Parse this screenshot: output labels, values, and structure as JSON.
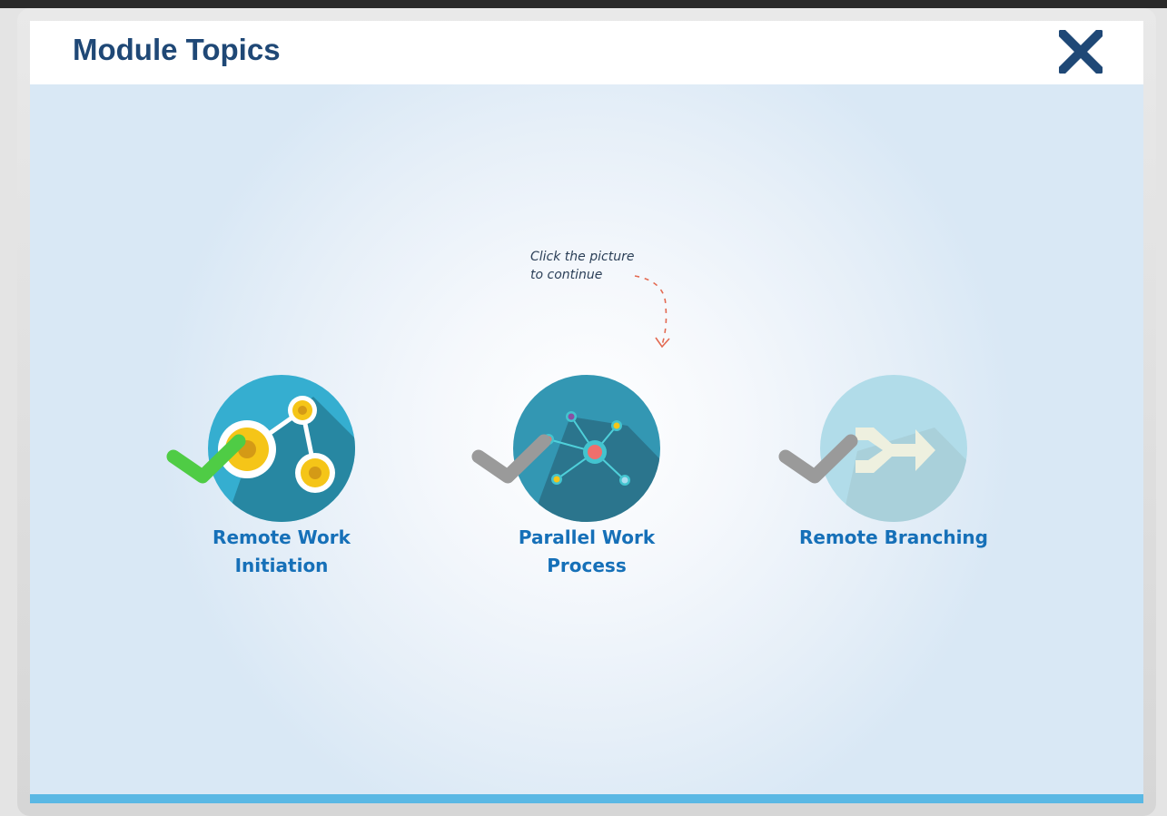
{
  "header": {
    "title": "Module Topics",
    "close_icon": "close-x-icon"
  },
  "hint": {
    "line1": "Click the picture",
    "line2": "to continue"
  },
  "topics": [
    {
      "line1": "Remote Work",
      "line2": "Initiation",
      "icon": "network-nodes-icon",
      "status": "completed",
      "check_color": "#4fcc45"
    },
    {
      "line1": "Parallel Work",
      "line2": "Process",
      "icon": "hub-network-icon",
      "status": "not-completed",
      "check_color": "#9a9a9a"
    },
    {
      "line1": "Remote Branching",
      "line2": "",
      "icon": "merge-arrows-icon",
      "status": "not-completed",
      "check_color": "#9a9a9a"
    }
  ],
  "colors": {
    "title": "#1f4876",
    "topic_label": "#1670b8",
    "bottom_bar": "#5ab8e4"
  }
}
